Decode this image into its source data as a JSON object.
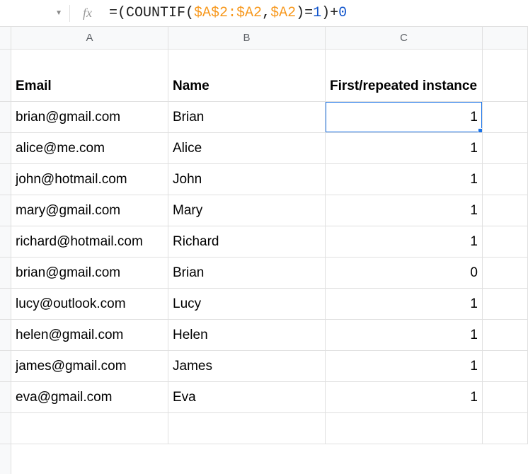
{
  "formula_bar": {
    "fx_label": "fx",
    "formula_parts": {
      "p1": "=(COUNTIF(",
      "p2": "$A$2:$A2",
      "p3": ",",
      "p4": "$A2",
      "p5": ")=",
      "p6": "1",
      "p7": ")+",
      "p8": "0"
    }
  },
  "columns": {
    "a": "A",
    "b": "B",
    "c": "C"
  },
  "headers": {
    "email": "Email",
    "name": "Name",
    "instance": "First/repeated instance"
  },
  "rows": [
    {
      "email": "brian@gmail.com",
      "name": "Brian",
      "instance": "1"
    },
    {
      "email": "alice@me.com",
      "name": "Alice",
      "instance": "1"
    },
    {
      "email": "john@hotmail.com",
      "name": "John",
      "instance": "1"
    },
    {
      "email": "mary@gmail.com",
      "name": "Mary",
      "instance": "1"
    },
    {
      "email": "richard@hotmail.com",
      "name": "Richard",
      "instance": "1"
    },
    {
      "email": "brian@gmail.com",
      "name": "Brian",
      "instance": "0"
    },
    {
      "email": "lucy@outlook.com",
      "name": "Lucy",
      "instance": "1"
    },
    {
      "email": "helen@gmail.com",
      "name": "Helen",
      "instance": "1"
    },
    {
      "email": "james@gmail.com",
      "name": "James",
      "instance": "1"
    },
    {
      "email": "eva@gmail.com",
      "name": "Eva",
      "instance": "1"
    }
  ],
  "selected_cell": {
    "row": 0,
    "col": "c"
  }
}
